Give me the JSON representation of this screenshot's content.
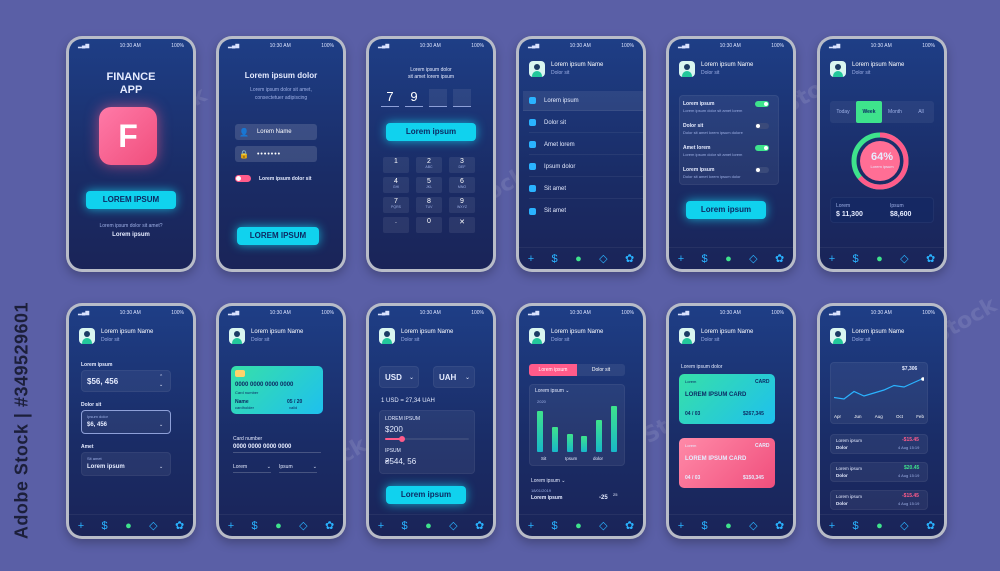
{
  "status": {
    "time": "10:30 AM",
    "battery": "100%"
  },
  "nav_icons": [
    "+",
    "$",
    "👤",
    "🛡",
    "⚙"
  ],
  "watermarks": [
    "Adobe Stock"
  ],
  "side_id": "Adobe Stock | #349529601",
  "p1": {
    "title1": "FINANCE",
    "title2": "APP",
    "logo_letter": "F",
    "button": "LOREM IPSUM",
    "question": "Lorem ipsum dolor sit amet?",
    "link": "Lorem ipsum"
  },
  "p2": {
    "title": "Lorem ipsum dolor",
    "subtitle1": "Lorem ipsum dolor sit amet,",
    "subtitle2": "consectetuer adipiscing",
    "name": "Lorem Name",
    "password": "•••••••",
    "remember": "Lorem ipsum dolor sit",
    "button": "LOREM IPSUM"
  },
  "p3": {
    "header1": "Lorem ipsum dolor",
    "header2": "sit amet lorem ipsum",
    "pin": [
      "7",
      "9",
      "",
      ""
    ],
    "button": "Lorem ipsum",
    "keys": [
      [
        "1",
        ""
      ],
      [
        "2",
        "ABC"
      ],
      [
        "3",
        "DEF"
      ],
      [
        "4",
        "GHI"
      ],
      [
        "5",
        "JKL"
      ],
      [
        "6",
        "MNO"
      ],
      [
        "7",
        "PQRS"
      ],
      [
        "8",
        "TUV"
      ],
      [
        "9",
        "WXYZ"
      ],
      [
        ".",
        ""
      ],
      [
        "0",
        ""
      ],
      [
        "✕",
        ""
      ]
    ]
  },
  "p4": {
    "name": "Lorem ipsum Name",
    "sub": "Dolor sit",
    "menu": [
      "Lorem ipsum",
      "Dolor sit",
      "Amet lorem",
      "Ipsum dolor",
      "Sit amet",
      "Sit amet"
    ]
  },
  "p5": {
    "name": "Lorem ipsum Name",
    "sub": "Dolor sit",
    "settings": [
      {
        "title": "Lorem ipsum",
        "desc": "Lorem ipsum dolor sit amet lorem",
        "on": true
      },
      {
        "title": "Dolor sit",
        "desc": "Dolor sit amet lorem ipsum dolore",
        "on": false
      },
      {
        "title": "Amet lorem",
        "desc": "Lorem ipsum dolor sit amet lorem",
        "on": true
      },
      {
        "title": "Lorem ipsum",
        "desc": "Dolor sit amet lorem ipsum dolor",
        "on": false
      }
    ],
    "button": "Lorem ipsum"
  },
  "p6": {
    "tabs": [
      "Today",
      "Week",
      "Month",
      "All"
    ],
    "percent": "64%",
    "percent_value": 64,
    "percent_label": "Lorem ipsum",
    "left_label": "Lorem",
    "left_value": "$ 11,300",
    "right_label": "Ipsum",
    "right_value": "$8,600"
  },
  "p7": {
    "name": "Lorem ipsum Name",
    "sub": "Dolor sit",
    "l1": "Lorem ipsum",
    "v1": "$56, 456",
    "l2": "Dolor sit",
    "f2_label": "Ipsum dolor",
    "v2": "$6, 456",
    "l3": "Amet",
    "f3_label": "Sit amet",
    "v3": "Lorem ipsum"
  },
  "p8": {
    "name": "Lorem ipsum Name",
    "sub": "Dolor sit",
    "card_number": "0000 0000 0000 0000",
    "card_number_label": "Card number",
    "card_name": "Name",
    "card_holder": "cardholder",
    "card_date": "05 / 20",
    "card_valid": "valid",
    "field_label": "Card number",
    "field_value": "0000 0000 0000 0000",
    "sel1": "Lorem",
    "sel2": "Ipsum"
  },
  "p9": {
    "name": "Lorem ipsum Name",
    "sub": "Dolor sit",
    "cur1": "USD",
    "cur2": "UAH",
    "rate": "1 USD = 27,34 UAH",
    "box_label1": "LOREM IPSUM",
    "amount1": "$200",
    "slider_value": 0.2,
    "box_label2": "IPSUM",
    "amount2": "₴544, 56",
    "button": "Lorem ipsum"
  },
  "p10": {
    "name": "Lorem ipsum Name",
    "sub": "Dolor sit",
    "tab1": "Lorem ipsum",
    "tab2": "Dolor sit",
    "dropdown": "Lorem ipsum",
    "year": "2020",
    "chart_labels": [
      "Sit",
      "Ipsum",
      "dolor"
    ],
    "bars": [
      0.9,
      0.55,
      0.4,
      0.35,
      0.7,
      1.0
    ],
    "dropdown2": "Lorem ipsum",
    "date": "18/01/2019",
    "item": "Lorem ipsum",
    "item_value": "-25",
    "item_sup": "25"
  },
  "p11": {
    "name": "Lorem ipsum Name",
    "sub": "Dolor sit",
    "top_label": "Lorem ipsum dolor",
    "card1": {
      "label": "Lorem",
      "type": "CARD",
      "title": "LOREM IPSUM CARD",
      "date": "04 / 03",
      "amount": "$267,345"
    },
    "card2": {
      "label": "Lorem",
      "type": "CARD",
      "title": "LOREM IPSUM CARD",
      "date": "04 / 03",
      "amount": "$150,345"
    }
  },
  "p12": {
    "name": "Lorem ipsum Name",
    "sub": "Dolor sit",
    "peak": "$7,306",
    "months": [
      "Apr",
      "Jun",
      "Aug",
      "Oct",
      "Feb"
    ],
    "line": [
      0.35,
      0.3,
      0.55,
      0.4,
      0.5,
      0.6,
      0.75,
      0.7,
      0.85,
      1.0
    ],
    "tx": [
      {
        "a": "Lorem ipsum",
        "b": "Dolor",
        "v": "-$15.45",
        "d": "4 Aug 15:19",
        "c": "#ff5b8a"
      },
      {
        "a": "Lorem ipsum",
        "b": "Dolor",
        "v": "$20.45",
        "d": "4 Aug 15:19",
        "c": "#3ee38c"
      },
      {
        "a": "Lorem ipsum",
        "b": "Dolor",
        "v": "-$15.45",
        "d": "4 Aug 15:19",
        "c": "#ff5b8a"
      }
    ]
  }
}
